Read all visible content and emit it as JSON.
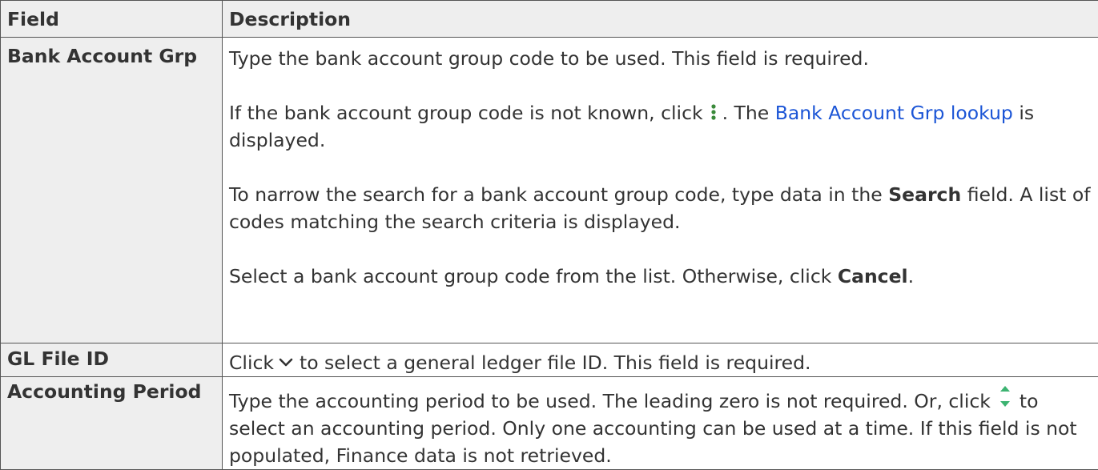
{
  "table": {
    "headers": {
      "field": "Field",
      "description": "Description"
    },
    "rows": {
      "bank": {
        "field": "Bank Account Grp",
        "p1": "Type the bank account group code to be used. This field is required.",
        "p2_pre": "If the bank account group code is not known, click",
        "p2_link": "Bank Account Grp lookup",
        "p2_mid": ". The",
        "p2_post": "is displayed.",
        "p3_pre": "To narrow the search for a bank account group code, type data in the",
        "p3_bold": "Search",
        "p3_post": "field. A list of codes matching the search criteria is displayed.",
        "p4_pre": "Select a bank account group code from the list. Otherwise, click",
        "p4_bold": "Cancel",
        "p4_post": "."
      },
      "gl": {
        "field": "GL File ID",
        "pre": "Click",
        "post": "to select a general ledger file ID. This field is required."
      },
      "period": {
        "field": "Accounting Period",
        "pre": "Type the accounting period to be used. The leading zero is not required. Or, click",
        "post": "to select an accounting period. Only one accounting can be used at a time. If this field is not populated, Finance data is not retrieved."
      }
    }
  },
  "icons": {
    "lookup": "kebab-menu-icon",
    "dropdown": "chevron-down-icon",
    "spinner": "up-down-arrows-icon"
  },
  "colors": {
    "link": "#1b55d6",
    "header_bg": "#eeeeee",
    "spinner_green": "#3cb371"
  }
}
